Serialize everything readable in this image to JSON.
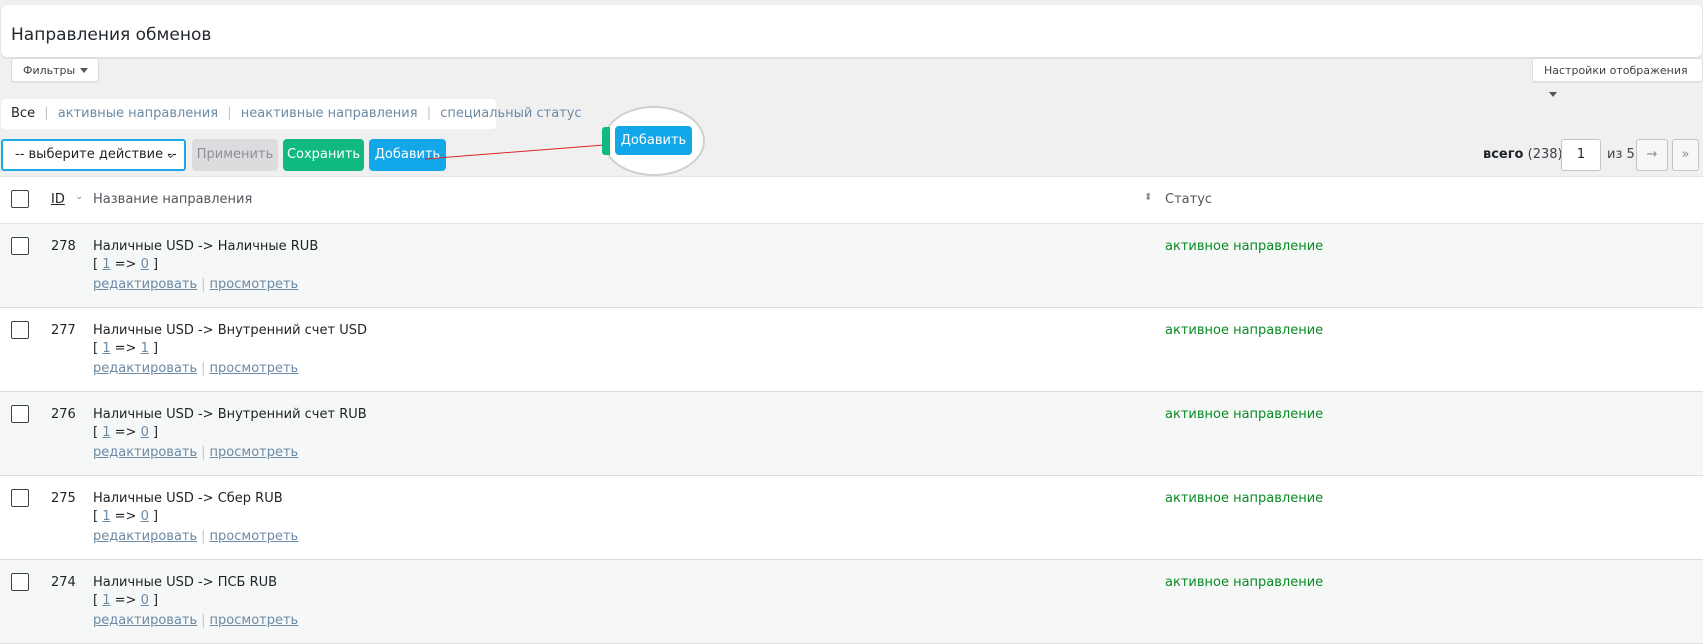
{
  "page": {
    "title": "Направления обменов"
  },
  "toolbar": {
    "filters_label": "Фильтры",
    "display_settings_label": "Настройки отображения"
  },
  "views": {
    "all": "Все",
    "active": "активные направления",
    "inactive": "неактивные направления",
    "special": "специальный статус",
    "separator": "|"
  },
  "bulk": {
    "select_placeholder": "-- выберите действие --",
    "apply_label": "Применить",
    "save_label": "Сохранить",
    "add_label": "Добавить",
    "add_zoom_label": "Добавить"
  },
  "pagination": {
    "total_label": "всего",
    "total_count": "(238)",
    "current_page": "1",
    "of_label": "из 5",
    "next_symbol": "→",
    "last_symbol": "»"
  },
  "table": {
    "col_id": "ID",
    "col_name": "Название направления",
    "col_status": "Статус",
    "action_edit": "редактировать",
    "action_view": "просмотреть",
    "rows": [
      {
        "id": "278",
        "name": "Наличные USD -> Наличные RUB",
        "from": "1",
        "to": "0",
        "status": "активное направление"
      },
      {
        "id": "277",
        "name": "Наличные USD -> Внутренний счет USD",
        "from": "1",
        "to": "1",
        "status": "активное направление"
      },
      {
        "id": "276",
        "name": "Наличные USD -> Внутренний счет RUB",
        "from": "1",
        "to": "0",
        "status": "активное направление"
      },
      {
        "id": "275",
        "name": "Наличные USD -> Сбер RUB",
        "from": "1",
        "to": "0",
        "status": "активное направление"
      },
      {
        "id": "274",
        "name": "Наличные USD -> ПСБ RUB",
        "from": "1",
        "to": "0",
        "status": "активное направление"
      }
    ]
  },
  "colors": {
    "accent_blue": "#12a7e8",
    "accent_green": "#0fb97f",
    "status_green": "#0a8a23"
  }
}
